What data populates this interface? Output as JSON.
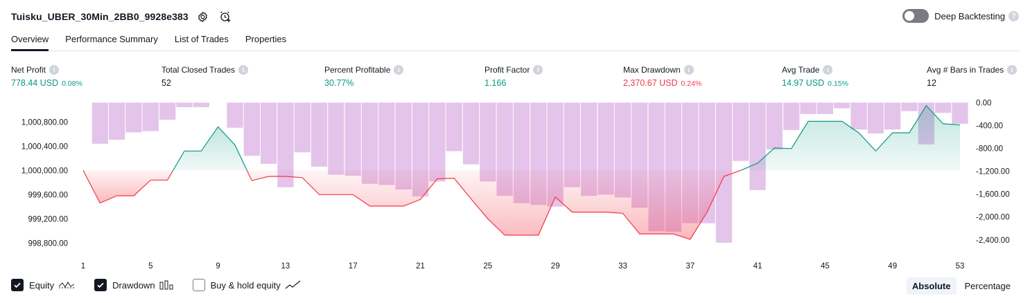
{
  "header": {
    "title": "Tuisku_UBER_30Min_2BB0_9928e383"
  },
  "deep_backtesting": {
    "label": "Deep Backtesting",
    "enabled": false
  },
  "tabs": [
    {
      "label": "Overview",
      "active": true
    },
    {
      "label": "Performance Summary",
      "active": false
    },
    {
      "label": "List of Trades",
      "active": false
    },
    {
      "label": "Properties",
      "active": false
    }
  ],
  "metrics": {
    "net_profit": {
      "label": "Net Profit",
      "value": "778.44 USD",
      "pct": "0.08%"
    },
    "total_closed_trades": {
      "label": "Total Closed Trades",
      "value": "52"
    },
    "percent_profitable": {
      "label": "Percent Profitable",
      "value": "30.77%"
    },
    "profit_factor": {
      "label": "Profit Factor",
      "value": "1.166"
    },
    "max_drawdown": {
      "label": "Max Drawdown",
      "value": "2,370.67 USD",
      "pct": "0.24%"
    },
    "avg_trade": {
      "label": "Avg Trade",
      "value": "14.97 USD",
      "pct": "0.15%"
    },
    "avg_bars": {
      "label": "Avg # Bars in Trades",
      "value": "12"
    }
  },
  "colors": {
    "profit": "#089981",
    "loss": "#f23645",
    "drawdown_bar": "#ce93d8",
    "text": "#131722"
  },
  "chart_data": {
    "type": "line",
    "x": [
      1,
      2,
      3,
      4,
      5,
      6,
      7,
      8,
      9,
      10,
      11,
      12,
      13,
      14,
      15,
      16,
      17,
      18,
      19,
      20,
      21,
      22,
      23,
      24,
      25,
      26,
      27,
      28,
      29,
      30,
      31,
      32,
      33,
      34,
      35,
      36,
      37,
      38,
      39,
      40,
      41,
      42,
      43,
      44,
      45,
      46,
      47,
      48,
      49,
      50,
      51,
      52,
      53
    ],
    "x_ticks": [
      1,
      5,
      9,
      13,
      17,
      21,
      25,
      29,
      33,
      37,
      41,
      45,
      49,
      53
    ],
    "left_axis": {
      "ticks": [
        "1,000,800.00",
        "1,000,400.00",
        "1,000,000.00",
        "999,600.00",
        "999,200.00",
        "998,800.00"
      ],
      "ylim": [
        998700,
        1001100
      ]
    },
    "right_axis": {
      "ticks": [
        "0.00",
        "-400.00",
        "-800.00",
        "-1,200.00",
        "-1,600.00",
        "-2,000.00",
        "-2,400.00"
      ],
      "ylim": [
        -2560,
        -20
      ]
    },
    "baseline": 1000000,
    "series": [
      {
        "name": "Equity",
        "axis": "left",
        "values": [
          1000000,
          999460,
          999580,
          999580,
          999840,
          999840,
          1000320,
          1000320,
          1000720,
          1000420,
          999830,
          999900,
          999900,
          999880,
          999600,
          999600,
          999600,
          999410,
          999410,
          999410,
          999520,
          999860,
          999870,
          999530,
          999200,
          998930,
          998930,
          998930,
          999560,
          999310,
          999310,
          999310,
          999290,
          998950,
          998950,
          998950,
          998860,
          999310,
          999900,
          1000000,
          1000120,
          1000370,
          1000360,
          1000810,
          1000810,
          1000810,
          1000620,
          1000320,
          1000620,
          1000620,
          1001070,
          1000770,
          1000750
        ]
      },
      {
        "name": "Drawdown",
        "axis": "right",
        "values": [
          0,
          -720,
          -650,
          -520,
          -500,
          -300,
          -80,
          -80,
          0,
          -440,
          -930,
          -1070,
          -1480,
          -870,
          -1120,
          -1260,
          -1280,
          -1420,
          -1440,
          -1520,
          -1640,
          -1380,
          -850,
          -1080,
          -1380,
          -1630,
          -1760,
          -1790,
          -1820,
          -1480,
          -1630,
          -1610,
          -1660,
          -1840,
          -2250,
          -2260,
          -2110,
          -2110,
          -2450,
          -1020,
          -1530,
          -820,
          -480,
          -200,
          -200,
          -100,
          -470,
          -540,
          -470,
          -150,
          -730,
          -180,
          -370
        ]
      },
      {
        "name": "Buy & hold equity",
        "axis": "left",
        "values": []
      }
    ],
    "legend": [
      {
        "label": "Equity",
        "checked": true
      },
      {
        "label": "Drawdown",
        "checked": true
      },
      {
        "label": "Buy & hold equity",
        "checked": false
      }
    ],
    "grid": false
  },
  "mode": {
    "absolute": "Absolute",
    "percentage": "Percentage",
    "selected": "Absolute"
  }
}
